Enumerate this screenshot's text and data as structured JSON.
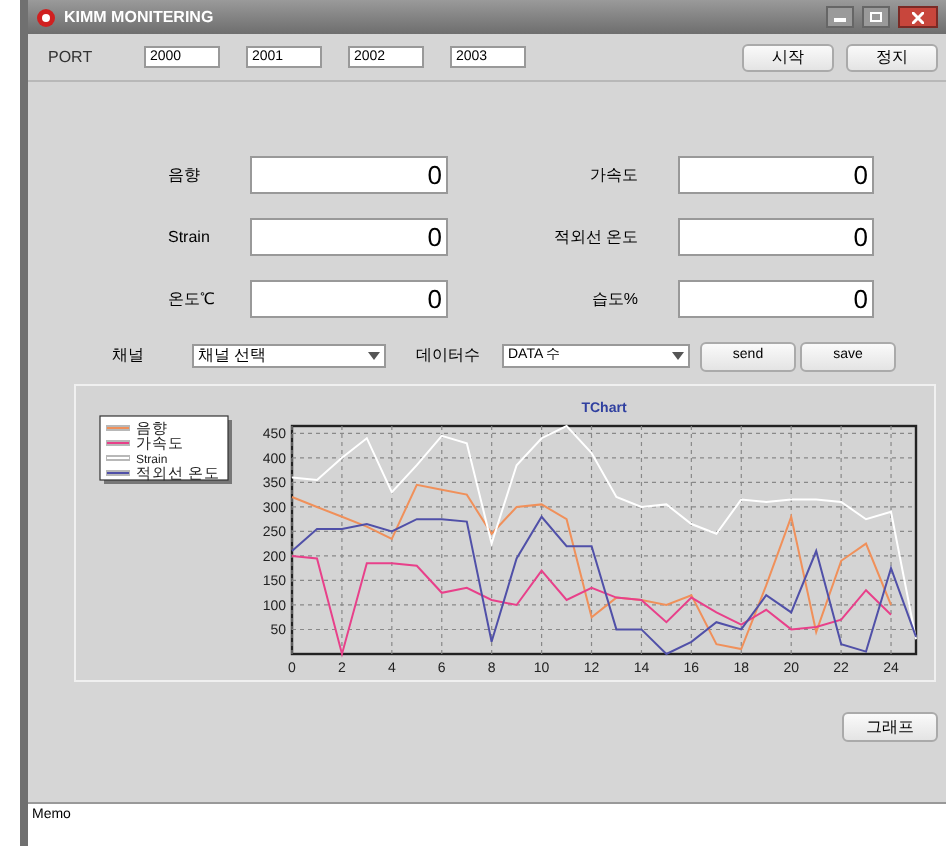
{
  "window": {
    "title": "KIMM MONITERING"
  },
  "port": {
    "label": "PORT",
    "values": [
      "2000",
      "2001",
      "2002",
      "2003"
    ]
  },
  "top_buttons": [
    "시작",
    "정지"
  ],
  "readings": [
    {
      "label": "음향",
      "value": "0"
    },
    {
      "label": "가속도",
      "value": "0"
    },
    {
      "label": "Strain",
      "value": "0"
    },
    {
      "label": "적외선 온도",
      "value": "0"
    },
    {
      "label": "온도℃",
      "value": "0"
    },
    {
      "label": "습도%",
      "value": "0"
    }
  ],
  "channel": {
    "label": "채널",
    "value": "채널 선택"
  },
  "data_count": {
    "label": "데이터수",
    "value": "DATA 수"
  },
  "action_buttons": [
    "send",
    "save"
  ],
  "chart_data": {
    "type": "line",
    "title": "TChart",
    "grid": true,
    "legend": "left",
    "x": [
      0,
      1,
      2,
      3,
      4,
      5,
      6,
      7,
      8,
      9,
      10,
      11,
      12,
      13,
      14,
      15,
      16,
      17,
      18,
      19,
      20,
      21,
      22,
      23,
      24,
      25
    ],
    "xlim": [
      0,
      25
    ],
    "ylim": [
      0,
      465
    ],
    "xticks": [
      0,
      2,
      4,
      6,
      8,
      10,
      12,
      14,
      16,
      18,
      20,
      22,
      24
    ],
    "yticks": [
      50,
      100,
      150,
      200,
      250,
      300,
      350,
      400,
      450
    ],
    "series": [
      {
        "name": "음향",
        "color": "#f0905a",
        "values": [
          320,
          300,
          280,
          260,
          235,
          345,
          335,
          325,
          245,
          300,
          305,
          275,
          75,
          115,
          110,
          100,
          120,
          20,
          10,
          140,
          280,
          45,
          190,
          225,
          100,
          null
        ]
      },
      {
        "name": "가속도",
        "color": "#e8408a",
        "values": [
          200,
          195,
          0,
          185,
          185,
          180,
          125,
          135,
          110,
          100,
          170,
          110,
          135,
          115,
          110,
          65,
          115,
          85,
          60,
          90,
          50,
          55,
          70,
          130,
          80,
          null
        ]
      },
      {
        "name": "Strain",
        "color": "#ffffff",
        "values": [
          360,
          355,
          400,
          440,
          330,
          385,
          445,
          430,
          225,
          385,
          440,
          465,
          410,
          320,
          300,
          305,
          265,
          245,
          315,
          310,
          315,
          315,
          310,
          275,
          290,
          30
        ]
      },
      {
        "name": "적외선 온도",
        "color": "#5050a8",
        "values": [
          210,
          255,
          255,
          265,
          250,
          275,
          275,
          270,
          25,
          195,
          280,
          220,
          220,
          50,
          50,
          0,
          25,
          65,
          50,
          120,
          85,
          210,
          20,
          5,
          175,
          35
        ]
      }
    ]
  },
  "graph_button": "그래프",
  "memo": {
    "value": "Memo"
  }
}
